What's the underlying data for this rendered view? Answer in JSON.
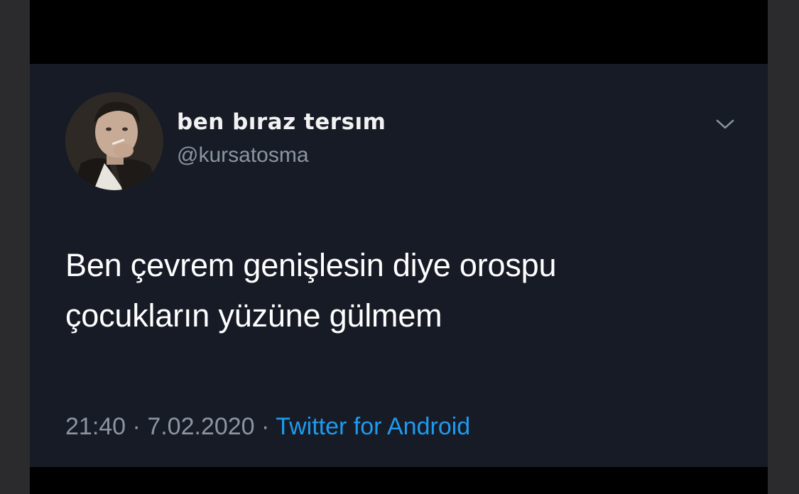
{
  "tweet": {
    "display_name": "ben bıraz tersım",
    "handle": "@kursatosma",
    "text_lines": [
      "Ben çevrem genişlesin diye orospu",
      "çocukların yüzüne gülmem"
    ],
    "time": "21:40",
    "separator_1": " · ",
    "date": "7.02.2020",
    "separator_2": " · ",
    "source": "Twitter for Android",
    "menu_icon": "chevron-down-icon",
    "avatar_icon": "avatar"
  },
  "colors": {
    "card_background": "#171b26",
    "text": "#ffffff",
    "muted_text": "#8b96a2",
    "link": "#1d9bf0"
  }
}
